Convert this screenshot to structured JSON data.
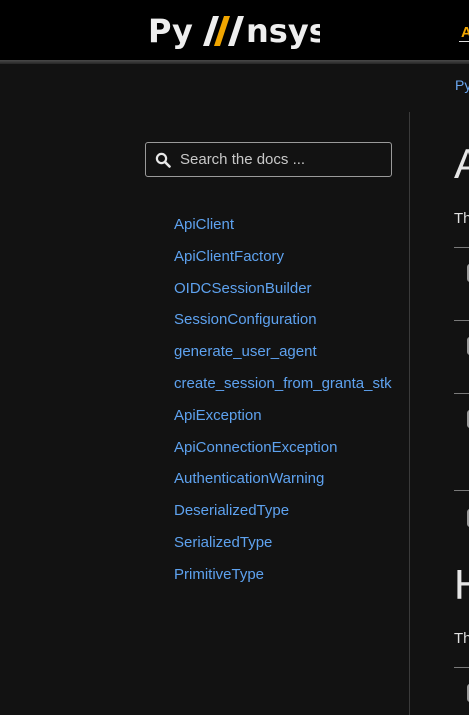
{
  "header": {
    "logo_text_left": "Py",
    "logo_text_right": "nsys",
    "accent_color": "#f0a500",
    "nav_fragment": "A"
  },
  "breadcrumb": {
    "fragment": "Py"
  },
  "search": {
    "placeholder": "Search the docs ...",
    "value": ""
  },
  "sidebar": {
    "items": [
      {
        "label": "ApiClient"
      },
      {
        "label": "ApiClientFactory"
      },
      {
        "label": "OIDCSessionBuilder"
      },
      {
        "label": "SessionConfiguration"
      },
      {
        "label": "generate_user_agent"
      },
      {
        "label": "create_session_from_granta_stk"
      },
      {
        "label": "ApiException"
      },
      {
        "label": "ApiConnectionException"
      },
      {
        "label": "AuthenticationWarning"
      },
      {
        "label": "DeserializedType"
      },
      {
        "label": "SerializedType"
      },
      {
        "label": "PrimitiveType"
      }
    ]
  },
  "content": {
    "heading_1": "A",
    "paragraph_1": "Th",
    "heading_2": "H",
    "paragraph_2": "Th"
  },
  "colors": {
    "background": "#121212",
    "topbar": "#000000",
    "link": "#5ea2ef",
    "text": "#e0e0e0"
  }
}
